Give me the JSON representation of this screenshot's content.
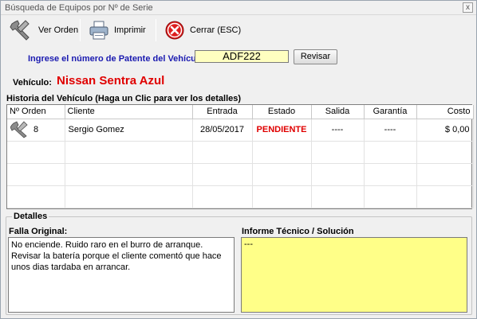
{
  "window": {
    "title": "Búsqueda de Equipos por Nº de Serie",
    "close_glyph": "x"
  },
  "toolbar": {
    "ver_orden": {
      "label": "Ver Orden",
      "icon": "wrench-icon"
    },
    "imprimir": {
      "label": "Imprimir",
      "icon": "printer-icon"
    },
    "cerrar": {
      "label": "Cerrar (ESC)",
      "icon": "close-circle-icon"
    }
  },
  "patente": {
    "label": "Ingrese el número de Patente del Vehículo:",
    "value": "ADF222",
    "button_label": "Revisar"
  },
  "vehiculo": {
    "label": "Vehículo:",
    "value": "Nissan Sentra Azul"
  },
  "historia": {
    "label": "Historia del Vehículo (Haga un Clic para ver los detalles)",
    "columns": [
      "Nº Orden",
      "Cliente",
      "Entrada",
      "Estado",
      "Salida",
      "Garantía",
      "Costo"
    ],
    "rows": [
      {
        "orden": "8",
        "cliente": "Sergio Gomez",
        "entrada": "28/05/2017",
        "estado": "PENDIENTE",
        "salida": "----",
        "garantia": "----",
        "costo": "$ 0,00"
      }
    ]
  },
  "detalles": {
    "legend": "Detalles",
    "falla_label": "Falla Original:",
    "falla_text": "No enciende. Ruido raro en el burro de arranque. Revisar la batería porque el cliente comentó que hace unos dias tardaba en arrancar.",
    "informe_label": "Informe Técnico / Solución",
    "informe_text": "---"
  },
  "colors": {
    "accent_blue": "#1a1ab0",
    "alert_red": "#e00000",
    "input_yellow": "#ffffc0",
    "informe_yellow": "#ffff88"
  }
}
